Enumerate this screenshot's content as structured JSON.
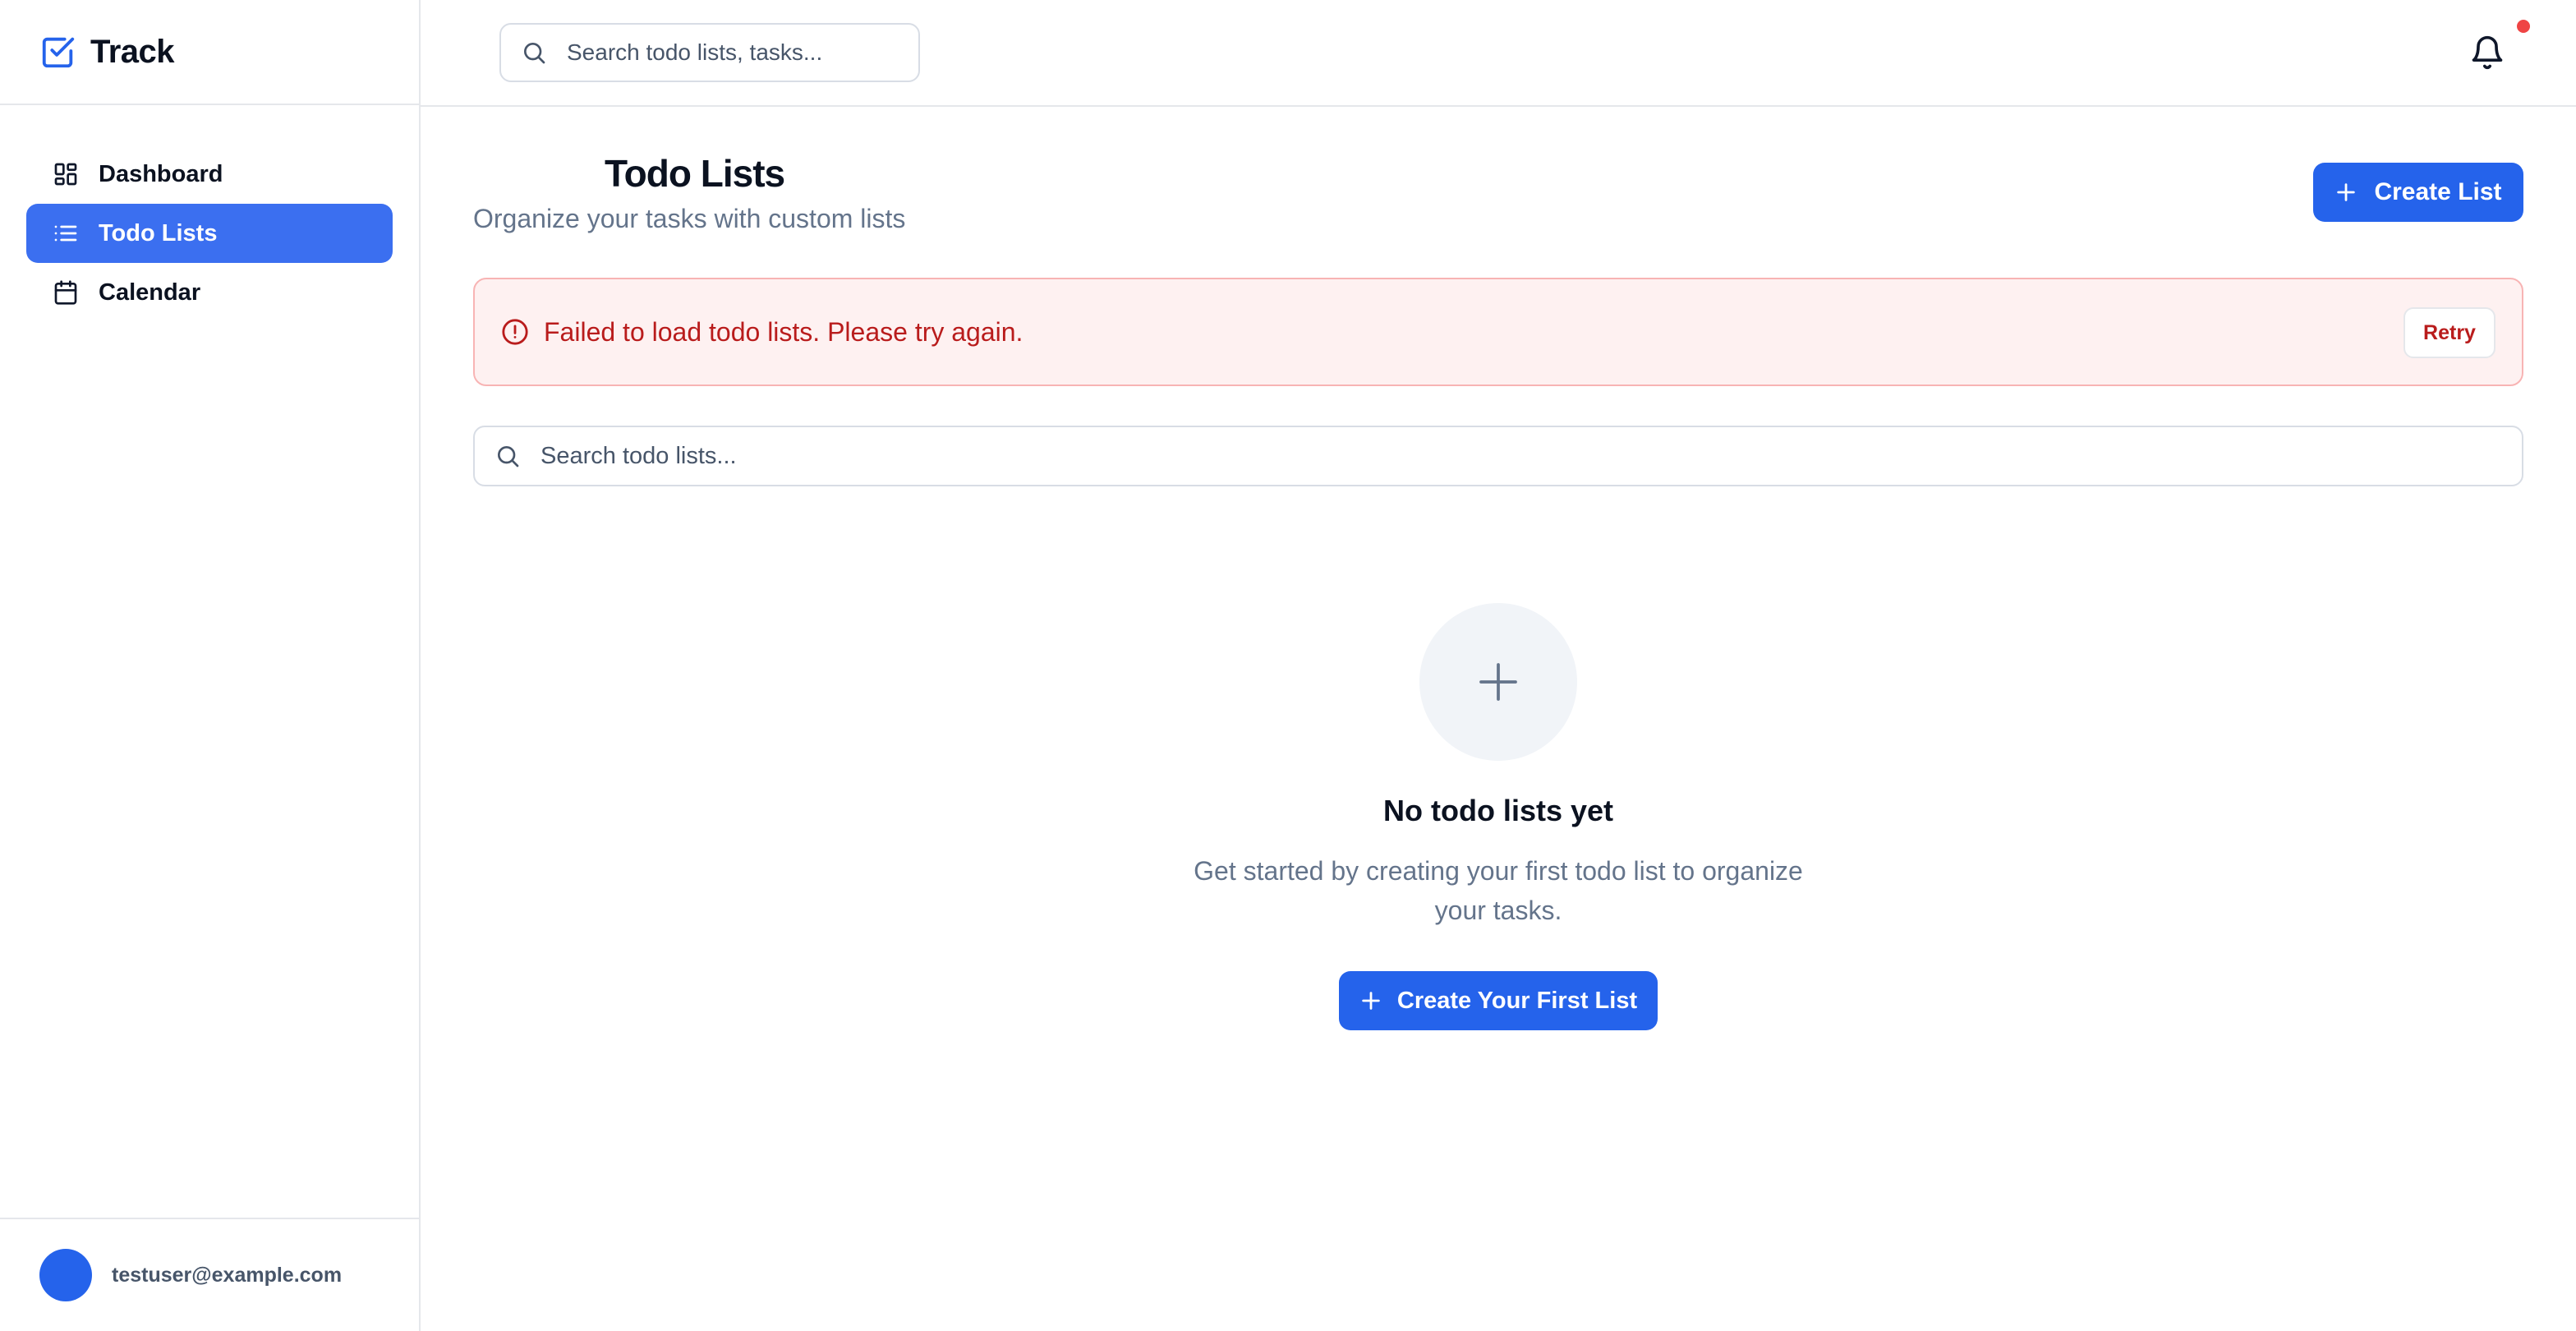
{
  "app": {
    "name": "Track"
  },
  "sidebar": {
    "items": [
      {
        "label": "Dashboard",
        "icon": "dashboard-icon",
        "active": false
      },
      {
        "label": "Todo Lists",
        "icon": "list-icon",
        "active": true
      },
      {
        "label": "Calendar",
        "icon": "calendar-icon",
        "active": false
      }
    ],
    "user": {
      "email": "testuser@example.com"
    }
  },
  "topbar": {
    "search_placeholder": "Search todo lists, tasks...",
    "notifications_icon": "bell-icon",
    "has_unread": true
  },
  "page": {
    "title": "Todo Lists",
    "subtitle": "Organize your tasks with custom lists",
    "create_label": "Create List"
  },
  "alert": {
    "message": "Failed to load todo lists. Please try again.",
    "retry_label": "Retry",
    "icon": "alert-circle-icon"
  },
  "list_search": {
    "placeholder": "Search todo lists..."
  },
  "empty_state": {
    "icon": "plus-icon",
    "title": "No todo lists yet",
    "description": "Get started by creating your first todo list to organize your tasks.",
    "button_label": "Create Your First List"
  },
  "colors": {
    "primary": "#2563eb",
    "active_nav": "#3b6ff0",
    "error_text": "#b91c1c",
    "error_bg": "#fef1f1",
    "notification_dot": "#ef4444"
  }
}
